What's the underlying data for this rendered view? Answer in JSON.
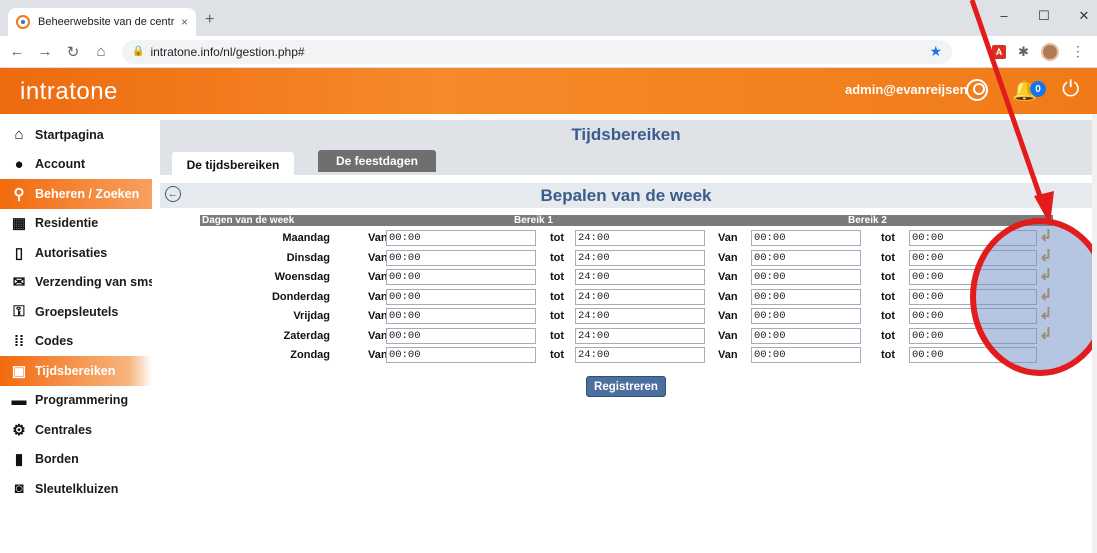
{
  "browser": {
    "tab_title": "Beheerwebsite van de centrales",
    "tab_close": "×",
    "new_tab": "+",
    "url": "intratone.info/nl/gestion.php#",
    "pdf_ext_label": "A"
  },
  "header": {
    "logo": "intratone",
    "user": "admin@evanreijsen",
    "notification_count": "0"
  },
  "sidebar": {
    "items": [
      {
        "label": "Startpagina",
        "icon": "home-icon"
      },
      {
        "label": "Account",
        "icon": "user-icon"
      },
      {
        "label": "Beheren / Zoeken",
        "icon": "search-icon"
      },
      {
        "label": "Residentie",
        "icon": "building-icon"
      },
      {
        "label": "Autorisaties",
        "icon": "door-icon"
      },
      {
        "label": "Verzending van sms",
        "icon": "envelope-icon"
      },
      {
        "label": "Groepsleutels",
        "icon": "key-icon"
      },
      {
        "label": "Codes",
        "icon": "keypad-icon"
      },
      {
        "label": "Tijdsbereiken",
        "icon": "calendar-clock-icon"
      },
      {
        "label": "Programmering",
        "icon": "programmer-icon"
      },
      {
        "label": "Centrales",
        "icon": "gear-icon"
      },
      {
        "label": "Borden",
        "icon": "panel-icon"
      },
      {
        "label": "Sleutelkluizen",
        "icon": "safe-icon"
      }
    ]
  },
  "main": {
    "title": "Tijdsbereiken",
    "tabs": [
      {
        "label": "De tijdsbereiken",
        "active": true
      },
      {
        "label": "De feestdagen",
        "active": false
      }
    ],
    "section_title": "Bepalen van de week",
    "grid": {
      "col_days": "Dagen van de week",
      "col_range1": "Bereik 1",
      "col_range2": "Bereik 2",
      "label_from": "Van",
      "label_to": "tot",
      "rows": [
        {
          "day": "Maandag",
          "r1_from": "00:00",
          "r1_to": "24:00",
          "r2_from": "00:00",
          "r2_to": "00:00"
        },
        {
          "day": "Dinsdag",
          "r1_from": "00:00",
          "r1_to": "24:00",
          "r2_from": "00:00",
          "r2_to": "00:00"
        },
        {
          "day": "Woensdag",
          "r1_from": "00:00",
          "r1_to": "24:00",
          "r2_from": "00:00",
          "r2_to": "00:00"
        },
        {
          "day": "Donderdag",
          "r1_from": "00:00",
          "r1_to": "24:00",
          "r2_from": "00:00",
          "r2_to": "00:00"
        },
        {
          "day": "Vrijdag",
          "r1_from": "00:00",
          "r1_to": "24:00",
          "r2_from": "00:00",
          "r2_to": "00:00"
        },
        {
          "day": "Zaterdag",
          "r1_from": "00:00",
          "r1_to": "24:00",
          "r2_from": "00:00",
          "r2_to": "00:00"
        },
        {
          "day": "Zondag",
          "r1_from": "00:00",
          "r1_to": "24:00",
          "r2_from": "00:00",
          "r2_to": "00:00"
        }
      ]
    },
    "register_button": "Registreren"
  },
  "colors": {
    "brand_orange": "#f07a18",
    "title_blue": "#3c5d8c",
    "annotation_red": "#e21b1b"
  }
}
